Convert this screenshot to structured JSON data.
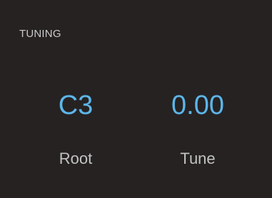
{
  "panel": {
    "title": "TUNING",
    "params": [
      {
        "value": "C3",
        "label": "Root"
      },
      {
        "value": "0.00",
        "label": "Tune"
      }
    ]
  },
  "colors": {
    "background": "#262222",
    "value_accent": "#5cb6ea",
    "label_text": "#c2c2c2"
  }
}
